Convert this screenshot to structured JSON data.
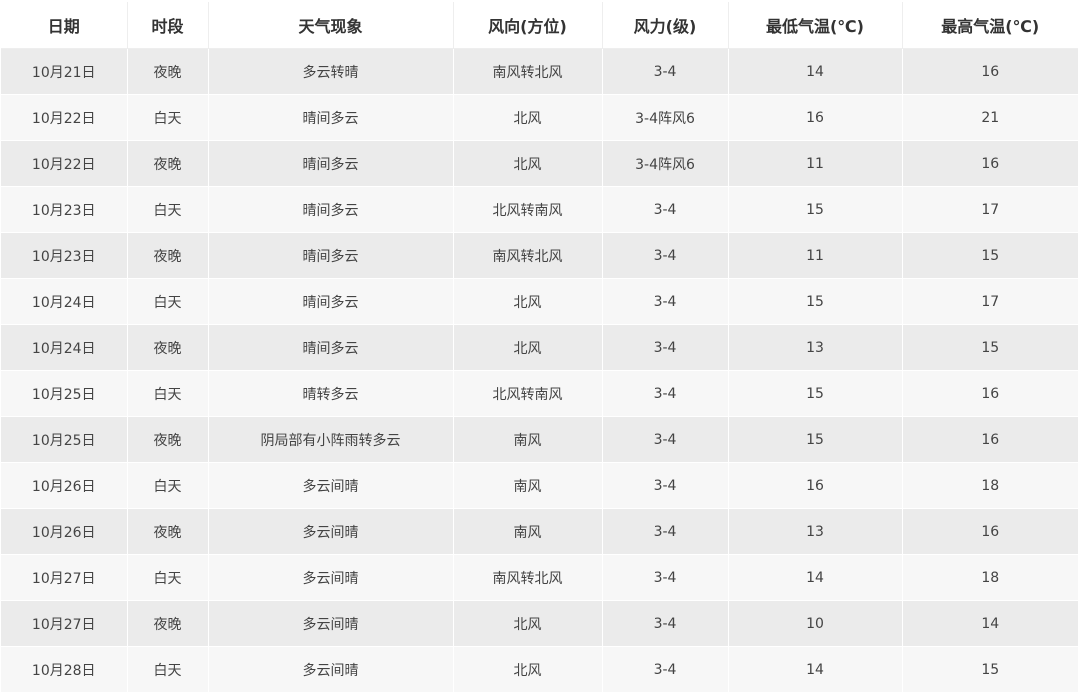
{
  "table": {
    "headers": [
      "日期",
      "时段",
      "天气现象",
      "风向(方位)",
      "风力(级)",
      "最低气温(℃)",
      "最高气温(℃)"
    ],
    "rows": [
      [
        "10月21日",
        "夜晚",
        "多云转晴",
        "南风转北风",
        "3-4",
        "14",
        "16"
      ],
      [
        "10月22日",
        "白天",
        "晴间多云",
        "北风",
        "3-4阵风6",
        "16",
        "21"
      ],
      [
        "10月22日",
        "夜晚",
        "晴间多云",
        "北风",
        "3-4阵风6",
        "11",
        "16"
      ],
      [
        "10月23日",
        "白天",
        "晴间多云",
        "北风转南风",
        "3-4",
        "15",
        "17"
      ],
      [
        "10月23日",
        "夜晚",
        "晴间多云",
        "南风转北风",
        "3-4",
        "11",
        "15"
      ],
      [
        "10月24日",
        "白天",
        "晴间多云",
        "北风",
        "3-4",
        "15",
        "17"
      ],
      [
        "10月24日",
        "夜晚",
        "晴间多云",
        "北风",
        "3-4",
        "13",
        "15"
      ],
      [
        "10月25日",
        "白天",
        "晴转多云",
        "北风转南风",
        "3-4",
        "15",
        "16"
      ],
      [
        "10月25日",
        "夜晚",
        "阴局部有小阵雨转多云",
        "南风",
        "3-4",
        "15",
        "16"
      ],
      [
        "10月26日",
        "白天",
        "多云间晴",
        "南风",
        "3-4",
        "16",
        "18"
      ],
      [
        "10月26日",
        "夜晚",
        "多云间晴",
        "南风",
        "3-4",
        "13",
        "16"
      ],
      [
        "10月27日",
        "白天",
        "多云间晴",
        "南风转北风",
        "3-4",
        "14",
        "18"
      ],
      [
        "10月27日",
        "夜晚",
        "多云间晴",
        "北风",
        "3-4",
        "10",
        "14"
      ],
      [
        "10月28日",
        "白天",
        "多云间晴",
        "北风",
        "3-4",
        "14",
        "15"
      ]
    ]
  }
}
